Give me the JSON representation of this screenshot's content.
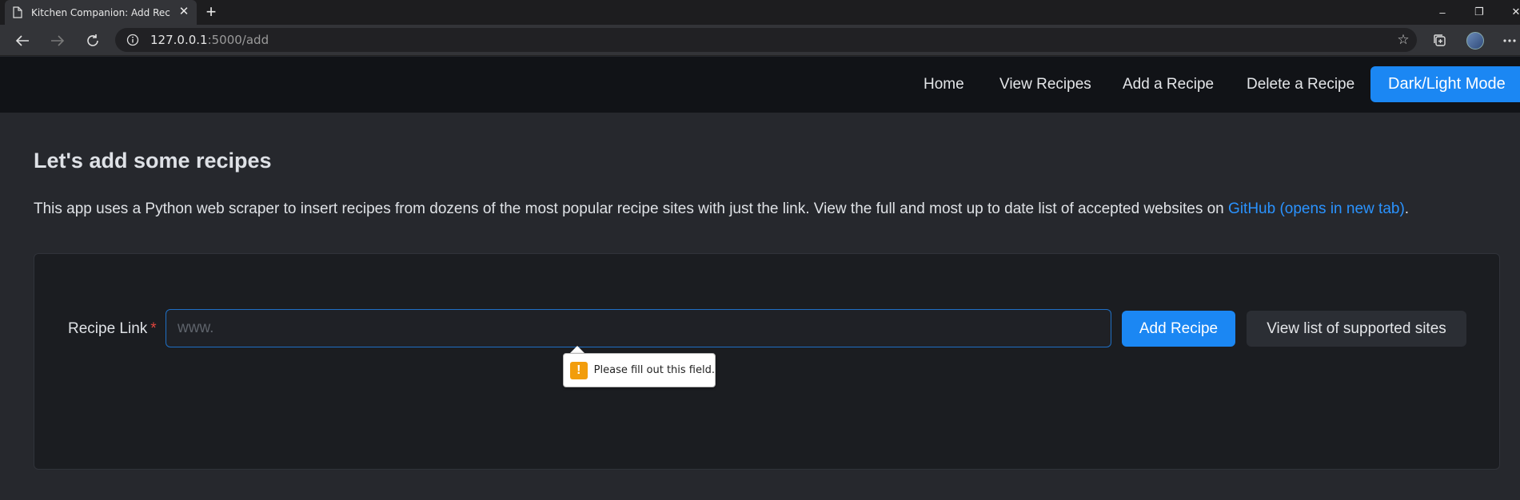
{
  "browser": {
    "tab_title": "Kitchen Companion: Add Recipe",
    "tab_close": "✕",
    "new_tab": "+",
    "address_host": "127.0.0.1",
    "address_path": ":5000/add",
    "window_controls": {
      "minimize": "–",
      "restore": "❐",
      "close": "✕"
    }
  },
  "nav": {
    "links": [
      "Home",
      "View Recipes",
      "Add a Recipe",
      "Delete a Recipe"
    ],
    "mode_button": "Dark/Light Mode"
  },
  "page": {
    "title": "Let's add some recipes",
    "intro_text": "This app uses a Python web scraper to insert recipes from dozens of the most popular recipe sites with just the link. View the full and most up to date list of accepted websites on ",
    "intro_link": "GitHub (opens in new tab)",
    "intro_end": "."
  },
  "form": {
    "label": "Recipe Link",
    "required_mark": "*",
    "input_value": "",
    "input_placeholder": "www.",
    "add_button": "Add Recipe",
    "sites_button": "View list of supported sites",
    "validation_message": "Please fill out this field.",
    "validation_icon": "!"
  },
  "colors": {
    "accent": "#1b87f3",
    "link": "#2a93ff",
    "required": "#e0453e",
    "warning": "#f29d0c",
    "background": "#26282d",
    "navbar": "#111317",
    "card": "#1b1d21"
  },
  "icons": [
    "page-icon",
    "back-icon",
    "forward-icon",
    "refresh-icon",
    "info-icon",
    "star-icon",
    "collections-icon",
    "profile-avatar",
    "more-icon",
    "warning-icon"
  ]
}
